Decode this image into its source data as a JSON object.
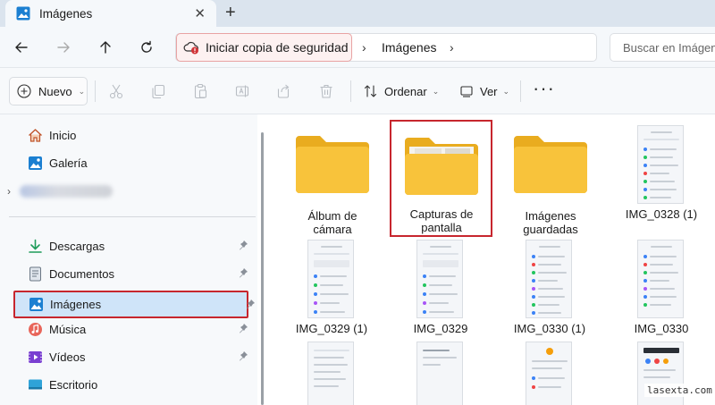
{
  "window": {
    "tab_title": "Imágenes"
  },
  "address": {
    "backup_label": "Iniciar copia de seguridad",
    "crumb": "Imágenes",
    "search_placeholder": "Buscar en Imágenes"
  },
  "toolbar": {
    "new_label": "Nuevo",
    "sort_label": "Ordenar",
    "view_label": "Ver"
  },
  "sidebar": {
    "top": [
      {
        "label": "Inicio",
        "icon": "home-icon"
      },
      {
        "label": "Galería",
        "icon": "gallery-icon"
      }
    ],
    "pinned": [
      {
        "label": "Descargas",
        "icon": "download-icon"
      },
      {
        "label": "Documentos",
        "icon": "documents-icon"
      },
      {
        "label": "Imágenes",
        "icon": "pictures-icon",
        "selected": true
      },
      {
        "label": "Música",
        "icon": "music-icon"
      },
      {
        "label": "Vídeos",
        "icon": "videos-icon"
      },
      {
        "label": "Escritorio",
        "icon": "desktop-icon"
      }
    ]
  },
  "content": {
    "folders": [
      {
        "name_line1": "Álbum de",
        "name_line2": "cámara"
      },
      {
        "name_line1": "Capturas de",
        "name_line2": "pantalla"
      },
      {
        "name_line1": "Imágenes",
        "name_line2": "guardadas"
      }
    ],
    "files": [
      "IMG_0328 (1)",
      "IMG_0329 (1)",
      "IMG_0329",
      "IMG_0330 (1)",
      "IMG_0330"
    ]
  },
  "watermark": "lasexta.com",
  "colors": {
    "accent": "#0067c0",
    "highlight_red": "#c7262e",
    "folder_yellow": "#f8c33b",
    "selected_bg": "#cfe4f9"
  }
}
